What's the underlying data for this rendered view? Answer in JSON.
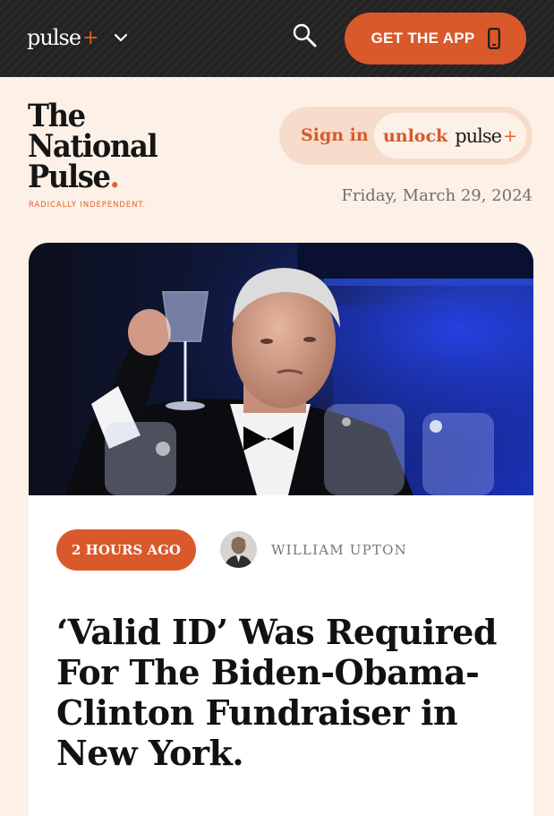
{
  "topbar": {
    "brand_word": "pulse",
    "brand_plus": "+",
    "get_app_label": "GET THE APP"
  },
  "header": {
    "logo_lines": [
      "The",
      "National",
      "Pulse"
    ],
    "logo_dot": ".",
    "tagline": "RADICALLY INDEPENDENT.",
    "sign_in_label": "Sign in",
    "unlock_label": "unlock",
    "unlock_brand": "pulse",
    "unlock_plus": "+",
    "date": "Friday, March 29, 2024"
  },
  "article": {
    "time_ago": "2 HOURS AGO",
    "author": "WILLIAM UPTON",
    "headline": "‘Valid ID’ Was Required For The Biden-Obama-Clinton Fundraiser in New York."
  },
  "colors": {
    "accent": "#d9592a",
    "topbar_bg": "#232323",
    "page_bg": "#fdf1e7",
    "pill_bg": "#f8dccb"
  },
  "icons": [
    "chevron-down-icon",
    "search-icon",
    "phone-icon"
  ]
}
